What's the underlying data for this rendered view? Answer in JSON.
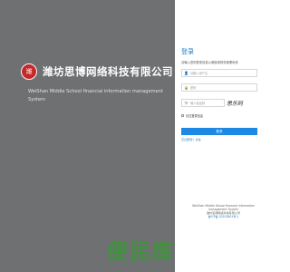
{
  "brand": {
    "logo_text": "潍",
    "name": "潍坊思博网络科技有限公司",
    "system_subtitle": "WeiShan Middle School financial information management System"
  },
  "login": {
    "title": "登录",
    "subtitle": "请输入您的登录信息以便使用财务管理系统",
    "username_placeholder": "请输入用户名",
    "password_placeholder": "密码",
    "captcha_placeholder": "输入验证码",
    "captcha_image_text": "思乐码",
    "remember_label": "记住登录信息",
    "button_label": "登录",
    "forgot_link": "忘记密码？点击"
  },
  "footer": {
    "line1": "WeiShan Middle School financial information",
    "line2": "management System",
    "line3": "潍坊思博网络科技有限公司",
    "line4": "鲁ICP备 20201801号-1"
  },
  "watermark": {
    "text": "便民库"
  },
  "colors": {
    "left_bg": "#6e7072",
    "accent": "#1e88e5",
    "watermark": "#3a9a36"
  }
}
